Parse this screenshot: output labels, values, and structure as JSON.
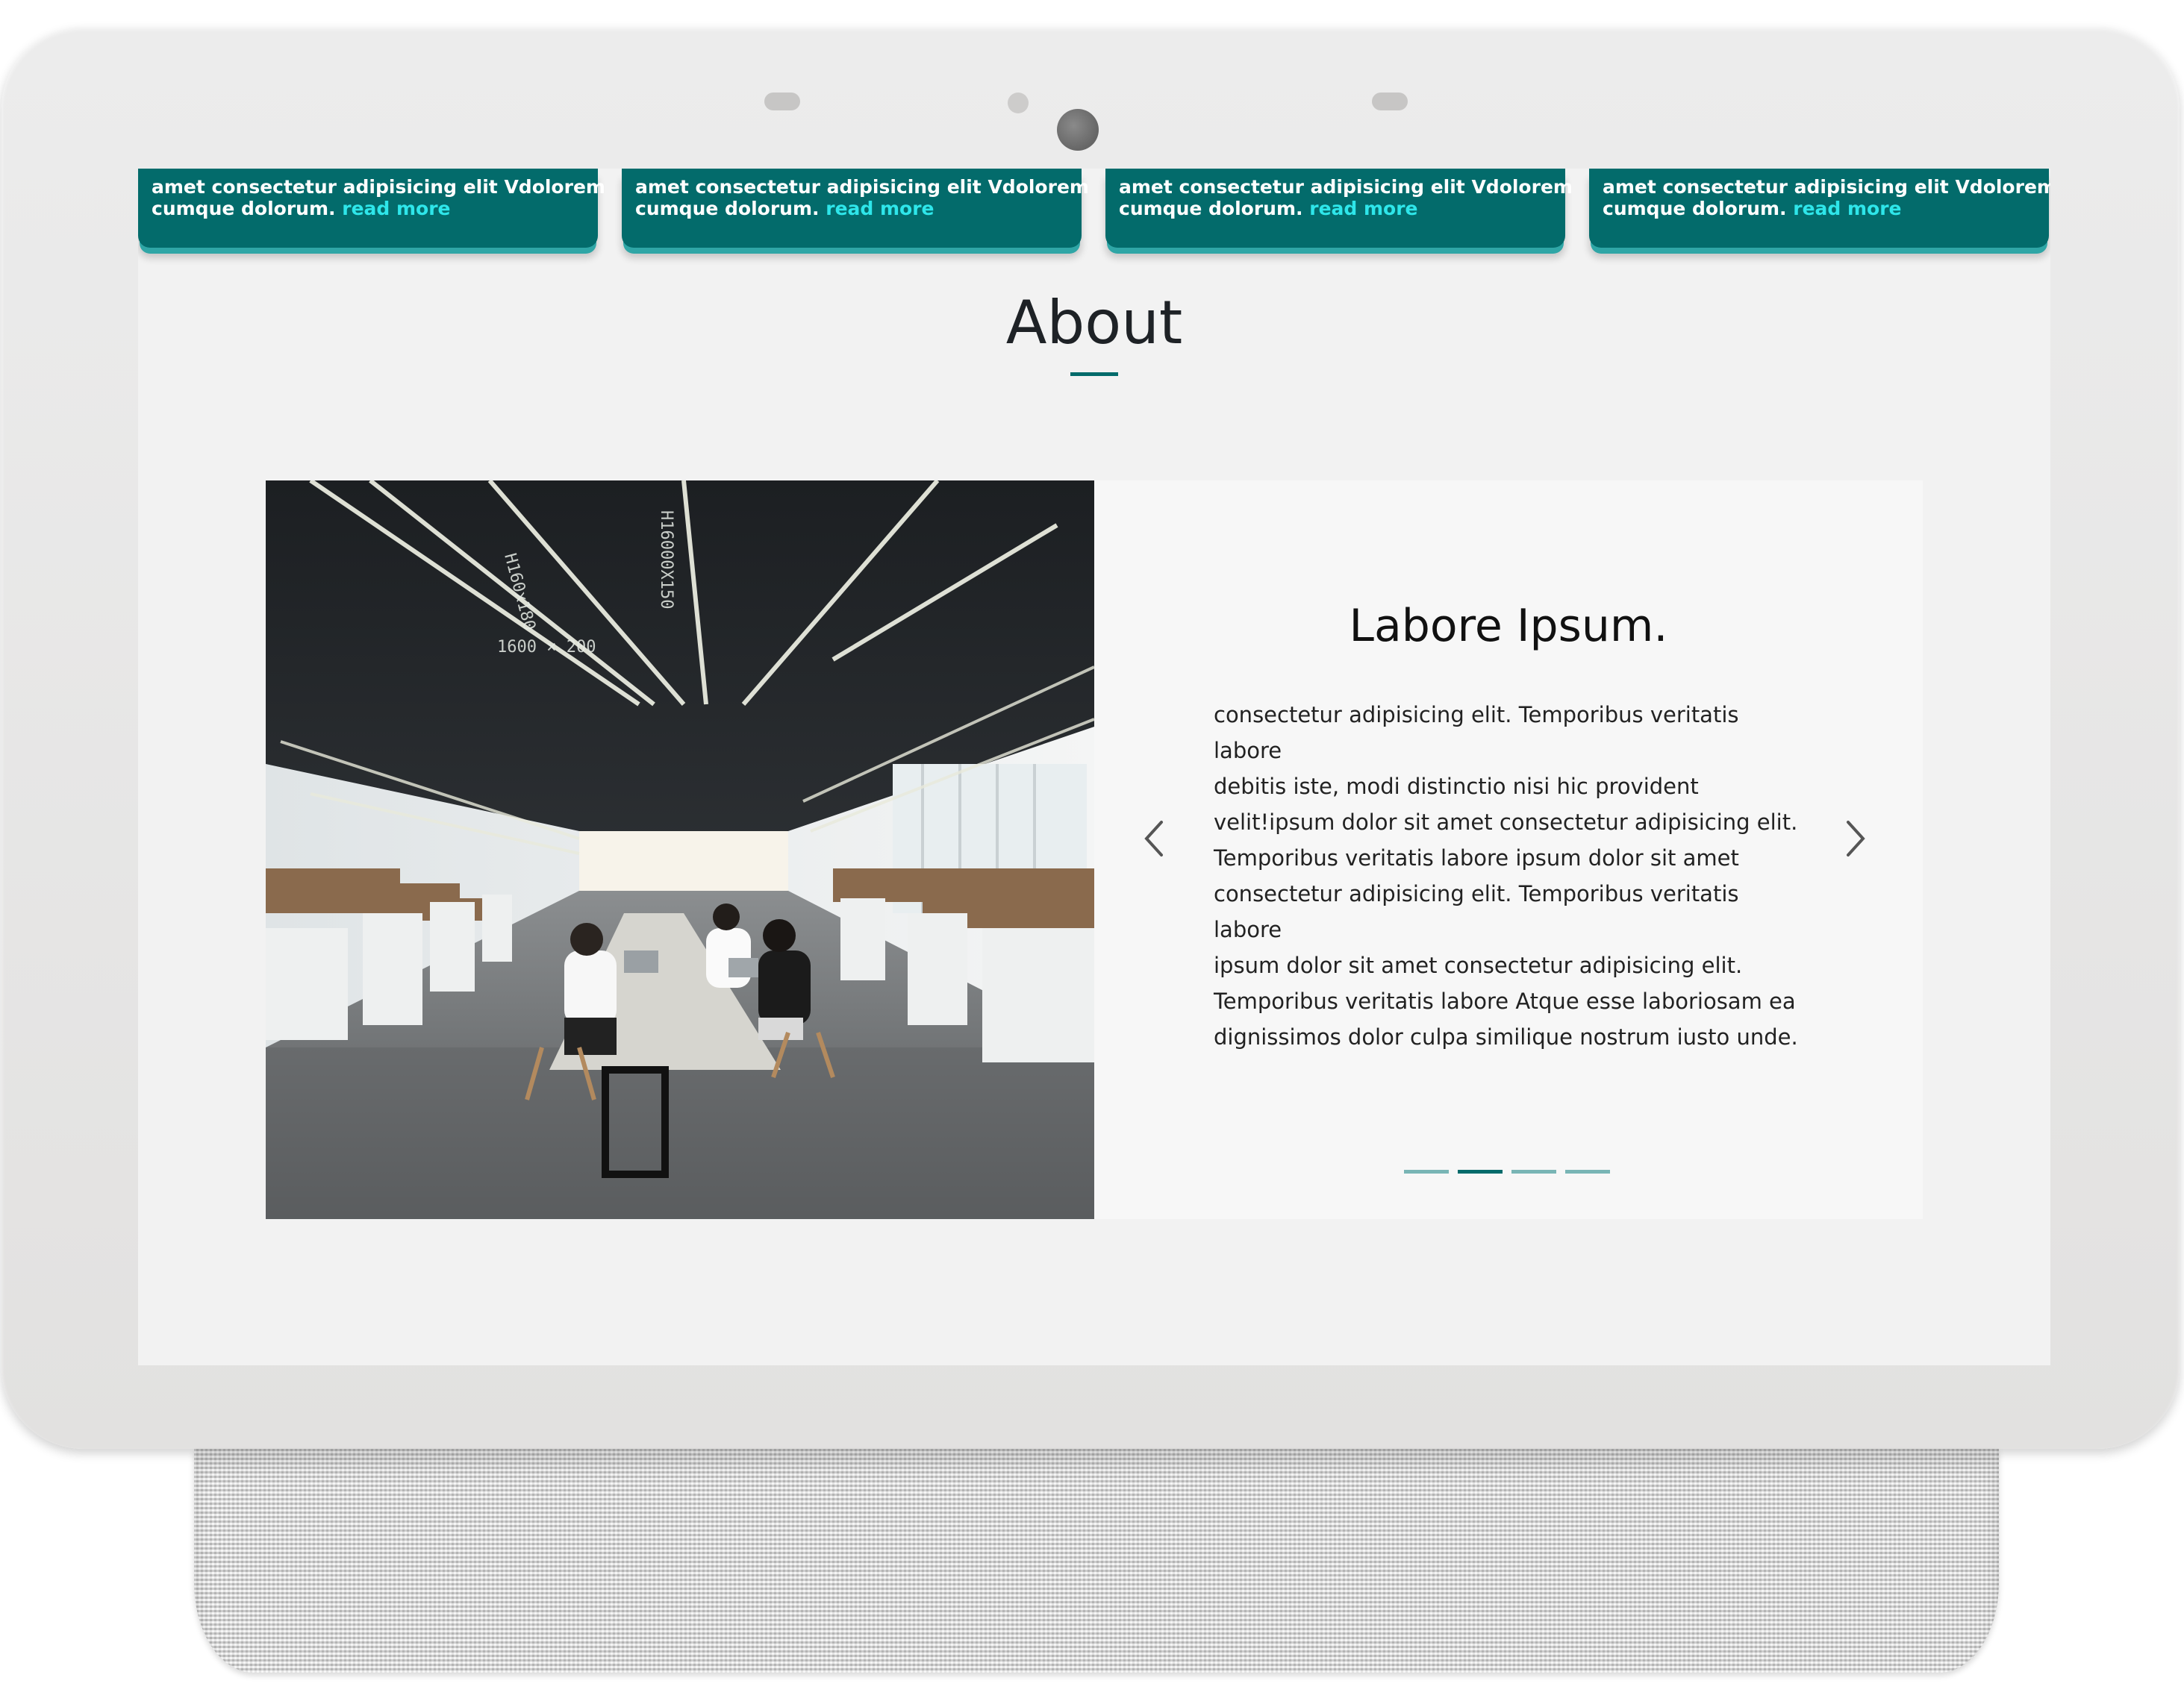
{
  "cards": [
    {
      "text": "amet consectetur adipisicing elit Vdolorem",
      "text2": "cumque dolorum.",
      "link": "read more"
    },
    {
      "text": "amet consectetur adipisicing elit Vdolorem",
      "text2": "cumque dolorum.",
      "link": "read more"
    },
    {
      "text": "amet consectetur adipisicing elit Vdolorem",
      "text2": "cumque dolorum.",
      "link": "read more"
    },
    {
      "text": "amet consectetur adipisicing elit Vdolorem",
      "text2": "cumque dolorum.",
      "link": "read more"
    }
  ],
  "about": {
    "title": "About"
  },
  "slide": {
    "title": "Labore Ipsum.",
    "lines": [
      "consectetur adipisicing elit. Temporibus veritatis labore",
      "debitis iste, modi distinctio nisi hic provident",
      "velit!ipsum dolor sit amet consectetur adipisicing elit.",
      "Temporibus veritatis labore ipsum dolor sit amet",
      "consectetur adipisicing elit. Temporibus veritatis labore",
      "ipsum dolor sit amet consectetur adipisicing elit.",
      "Temporibus veritatis labore Atque esse laboriosam ea",
      "dignissimos dolor culpa similique nostrum iusto unde."
    ],
    "active_index": 1,
    "count": 4
  },
  "colors": {
    "accent": "#036b6b",
    "link": "#2ee6ea",
    "dot_inactive": "#79b5b5"
  },
  "icons": [
    "chevron-left-icon",
    "chevron-right-icon"
  ]
}
